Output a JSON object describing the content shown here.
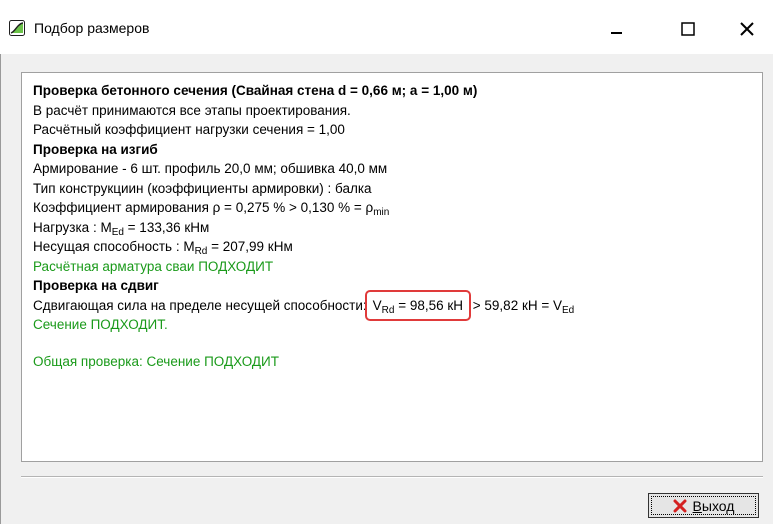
{
  "window": {
    "title": "Подбор размеров"
  },
  "report": {
    "section1": {
      "heading": "Проверка бетонного сечения (Свайная стена d = 0,66 м; a = 1,00 м)",
      "line1": "В расчёт принимаются все этапы проектирования.",
      "line2": "Расчётный коэффициент нагрузки сечения = 1,00"
    },
    "bending": {
      "heading": "Проверка на изгиб",
      "reinforcement": "Армирование - 6 шт. профиль 20,0 мм; обшивка 40,0 мм",
      "construction_type": "Тип конструкциин (коэффициенты армировки) : балка",
      "ratio_prefix": "Коэффициент армирования ρ = 0,275 % > 0,130 % = ρ",
      "ratio_sub": "min",
      "load_prefix": "Нагрузка : M",
      "load_sub": "Ed",
      "load_value": " = 133,36 кНм",
      "capacity_prefix": "Несущая способность : M",
      "capacity_sub": "Rd",
      "capacity_value": " = 207,99 кНм",
      "result": "Расчётная арматура сваи ПОДХОДИТ"
    },
    "shear": {
      "heading": "Проверка на сдвиг",
      "force_prefix": "Сдвигающая сила на пределе несущей способности:",
      "vrd_symbol": "V",
      "vrd_sub": "Rd",
      "vrd_value": " = 98,56 кН",
      "comparison": " > 59,82 кН = V",
      "ved_sub": "Ed",
      "result": "Сечение ПОДХОДИТ."
    },
    "overall": "Общая проверка: Сечение ПОДХОДИТ"
  },
  "footer": {
    "exit_accel": "В",
    "exit_rest": "ыход"
  },
  "colors": {
    "ok_text": "#1a9a1a",
    "highlight_border": "#e03a3a",
    "exit_icon": "#d42020"
  }
}
